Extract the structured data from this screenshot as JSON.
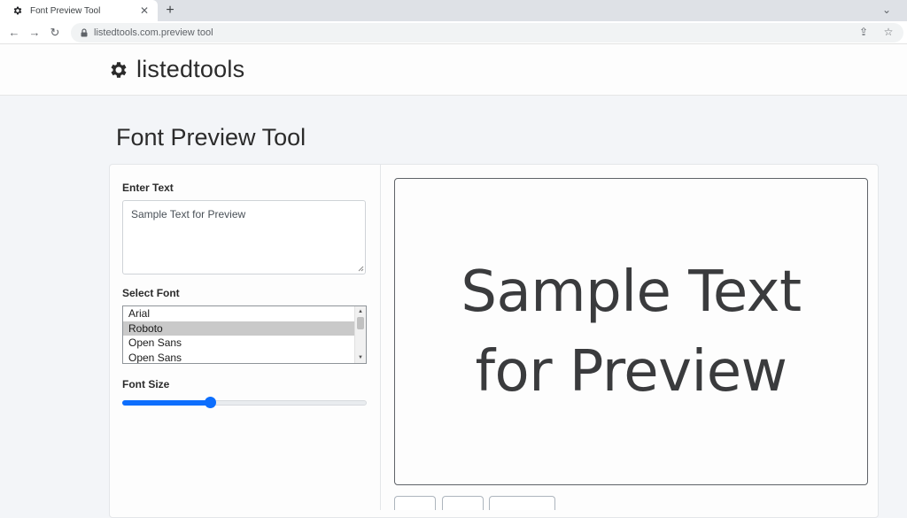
{
  "browser": {
    "tab_title": "Font Preview Tool",
    "url_host": "listedtools.com",
    "url_path": ".preview tool"
  },
  "site": {
    "brand": "listedtools"
  },
  "page": {
    "title": "Font Preview Tool"
  },
  "form": {
    "text_label": "Enter Text",
    "text_value": "Sample Text for Preview",
    "font_label": "Select Font",
    "font_options": [
      "Arial",
      "Roboto",
      "Open Sans",
      "Open Sans"
    ],
    "selected_font": "Roboto",
    "size_label": "Font Size",
    "size_fraction": 0.36
  },
  "preview": {
    "text": "Sample Text for Preview"
  }
}
